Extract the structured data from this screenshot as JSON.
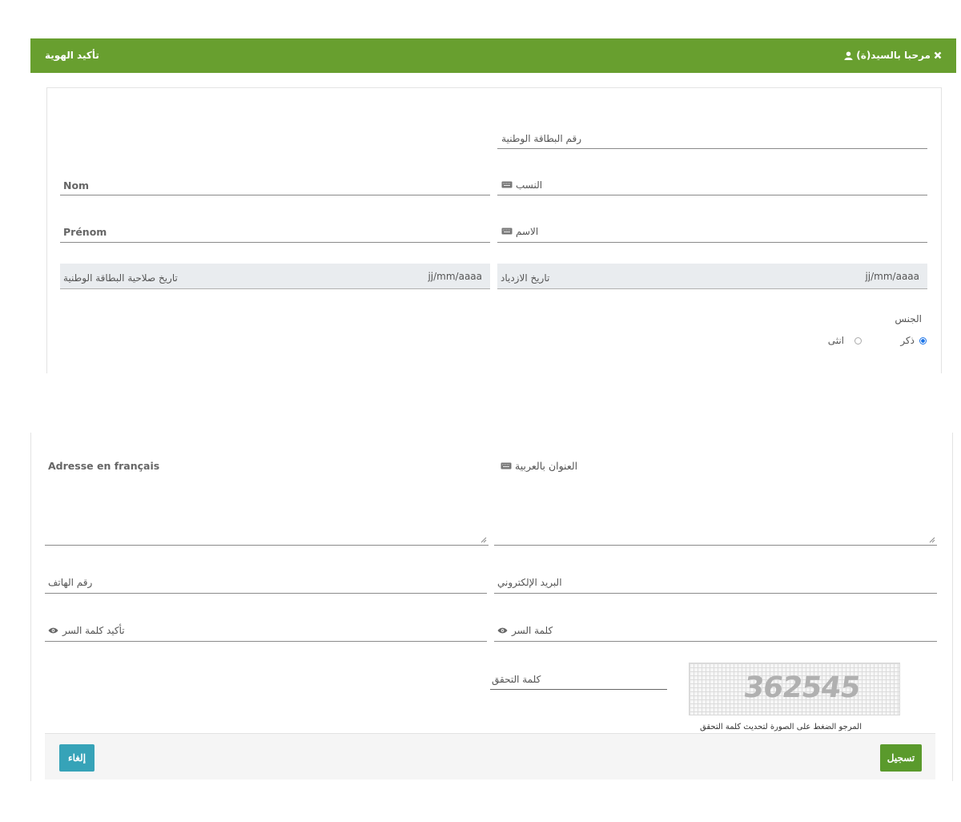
{
  "header": {
    "title": "تأكيد الهوية",
    "welcome": "مرحبا بالسيد(ة)",
    "icons": [
      "close-icon",
      "user-icon"
    ],
    "color": "#689f2f"
  },
  "identity": {
    "cin_label": "رقم البطاقة الوطنية",
    "nom_ar_label": "النسب",
    "nom_fr_label": "Nom",
    "prenom_ar_label": "الاسم",
    "prenom_fr_label": "Prénom",
    "birth_date_label": "تاريخ الازدياد",
    "birth_date_placeholder": "jj/mm/aaaa",
    "cin_expiry_label": "تاريخ صلاحية البطاقة الوطنية",
    "cin_expiry_placeholder": "jj/mm/aaaa",
    "gender_label": "الجنس",
    "gender_male": "ذكر",
    "gender_female": "انثى",
    "gender_selected": "male"
  },
  "contact": {
    "address_ar_label": "العنوان بالعربية",
    "address_fr_label": "Adresse en français",
    "email_label": "البريد الإلكتروني",
    "phone_label": "رقم الهاتف",
    "password_label": "كلمة السر",
    "password_confirm_label": "تأكيد كلمة السر",
    "captcha_label": "كلمة التحقق",
    "captcha_code": "362545",
    "captcha_note": "المرجو الضغط على الصورة لتحديث كلمة التحقق"
  },
  "footer": {
    "submit_label": "تسجيل",
    "cancel_label": "إلغاء",
    "submit_color": "#5a9a2c",
    "cancel_color": "#36a3b8"
  }
}
